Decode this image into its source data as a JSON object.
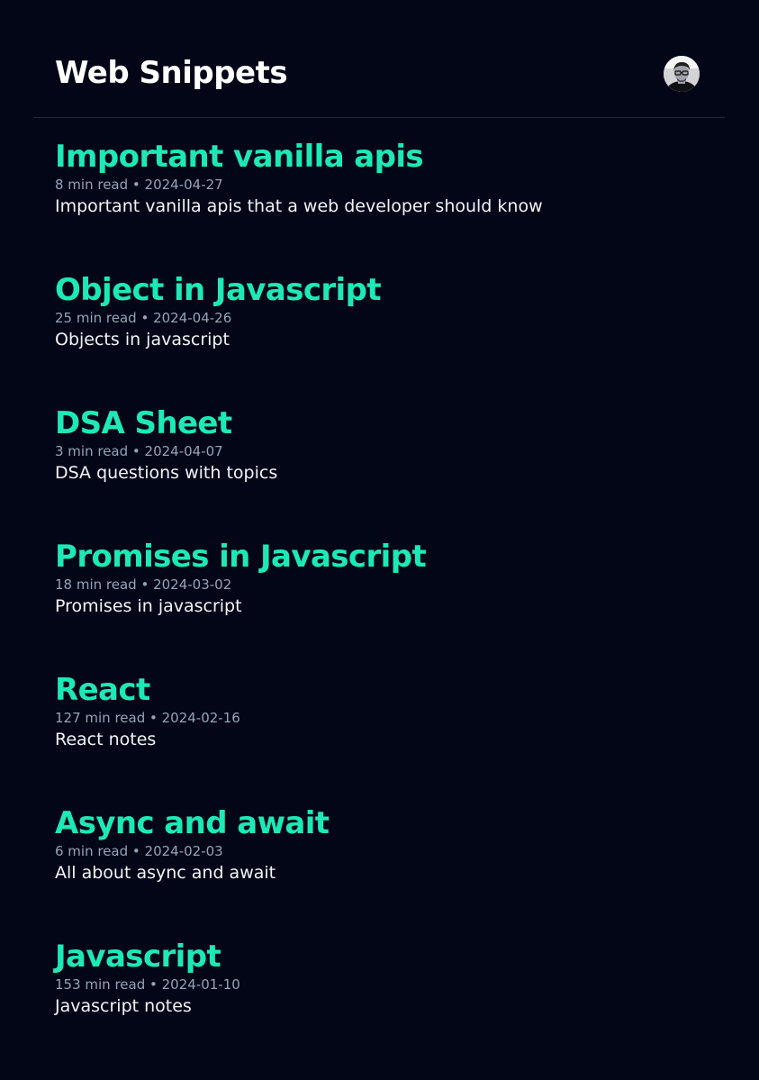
{
  "header": {
    "site_title": "Web Snippets"
  },
  "colors": {
    "background": "#020617",
    "accent": "#1de9b6",
    "meta_text": "#94a3b8",
    "body_text": "#f1f5f9"
  },
  "posts": [
    {
      "title": "Important vanilla apis",
      "meta": "8 min read • 2024-04-27",
      "description": "Important vanilla apis that a web developer should know"
    },
    {
      "title": "Object in Javascript",
      "meta": "25 min read • 2024-04-26",
      "description": "Objects in javascript"
    },
    {
      "title": "DSA Sheet",
      "meta": "3 min read • 2024-04-07",
      "description": "DSA questions with topics"
    },
    {
      "title": "Promises in Javascript",
      "meta": "18 min read • 2024-03-02",
      "description": "Promises in javascript"
    },
    {
      "title": "React",
      "meta": "127 min read • 2024-02-16",
      "description": "React notes"
    },
    {
      "title": "Async and await",
      "meta": "6 min read • 2024-02-03",
      "description": "All about async and await"
    },
    {
      "title": "Javascript",
      "meta": "153 min read • 2024-01-10",
      "description": "Javascript notes"
    }
  ]
}
